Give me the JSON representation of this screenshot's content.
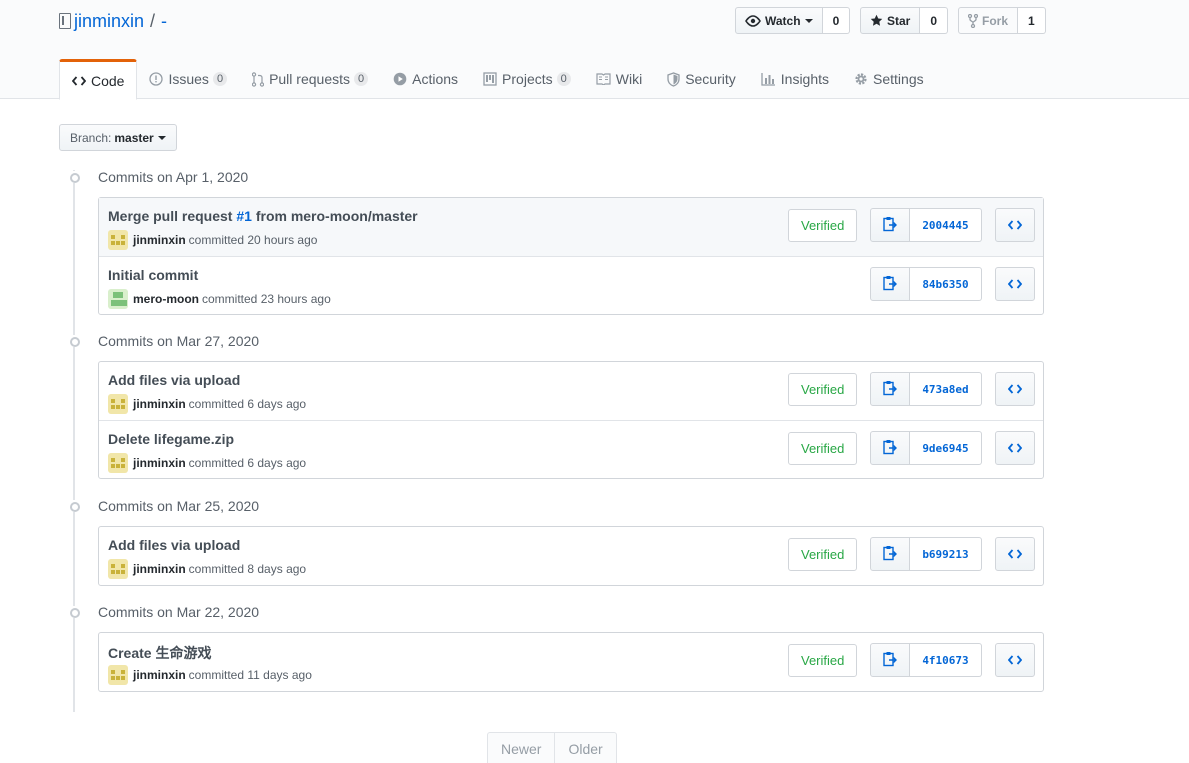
{
  "repo": {
    "owner": "jinminxin",
    "separator": "/",
    "name": "-"
  },
  "actions": {
    "watch": {
      "label": "Watch",
      "count": "0"
    },
    "star": {
      "label": "Star",
      "count": "0"
    },
    "fork": {
      "label": "Fork",
      "count": "1"
    }
  },
  "nav": [
    {
      "label": "Code",
      "icon": "code-icon"
    },
    {
      "label": "Issues",
      "count": "0",
      "icon": "issue-icon"
    },
    {
      "label": "Pull requests",
      "count": "0",
      "icon": "pull-request-icon"
    },
    {
      "label": "Actions",
      "icon": "play-icon"
    },
    {
      "label": "Projects",
      "count": "0",
      "icon": "project-icon"
    },
    {
      "label": "Wiki",
      "icon": "book-icon"
    },
    {
      "label": "Security",
      "icon": "shield-icon"
    },
    {
      "label": "Insights",
      "icon": "graph-icon"
    },
    {
      "label": "Settings",
      "icon": "gear-icon"
    }
  ],
  "branch": {
    "label": "Branch:",
    "value": "master"
  },
  "groups": [
    {
      "title": "Commits on Apr 1, 2020",
      "commits": [
        {
          "title_pre": "Merge pull request ",
          "title_link": "#1",
          "title_post": " from mero-moon/master",
          "author": "jinminxin",
          "verb": "committed",
          "when": "20 hours ago",
          "verified": "Verified",
          "sha": "2004445"
        },
        {
          "title_pre": "Initial commit",
          "title_link": "",
          "title_post": "",
          "author": "mero-moon",
          "verb": "committed",
          "when": "23 hours ago",
          "verified": "",
          "sha": "84b6350"
        }
      ]
    },
    {
      "title": "Commits on Mar 27, 2020",
      "commits": [
        {
          "title_pre": "Add files via upload",
          "title_link": "",
          "title_post": "",
          "author": "jinminxin",
          "verb": "committed",
          "when": "6 days ago",
          "verified": "Verified",
          "sha": "473a8ed"
        },
        {
          "title_pre": "Delete lifegame.zip",
          "title_link": "",
          "title_post": "",
          "author": "jinminxin",
          "verb": "committed",
          "when": "6 days ago",
          "verified": "Verified",
          "sha": "9de6945"
        }
      ]
    },
    {
      "title": "Commits on Mar 25, 2020",
      "commits": [
        {
          "title_pre": "Add files via upload",
          "title_link": "",
          "title_post": "",
          "author": "jinminxin",
          "verb": "committed",
          "when": "8 days ago",
          "verified": "Verified",
          "sha": "b699213"
        }
      ]
    },
    {
      "title": "Commits on Mar 22, 2020",
      "commits": [
        {
          "title_pre": "Create 生命游戏",
          "title_link": "",
          "title_post": "",
          "author": "jinminxin",
          "verb": "committed",
          "when": "11 days ago",
          "verified": "Verified",
          "sha": "4f10673"
        }
      ]
    }
  ],
  "pagination": {
    "newer": "Newer",
    "older": "Older"
  },
  "colors": {
    "link": "#0366d6",
    "verified": "#28a745",
    "nav_selected_accent": "#e36209"
  }
}
